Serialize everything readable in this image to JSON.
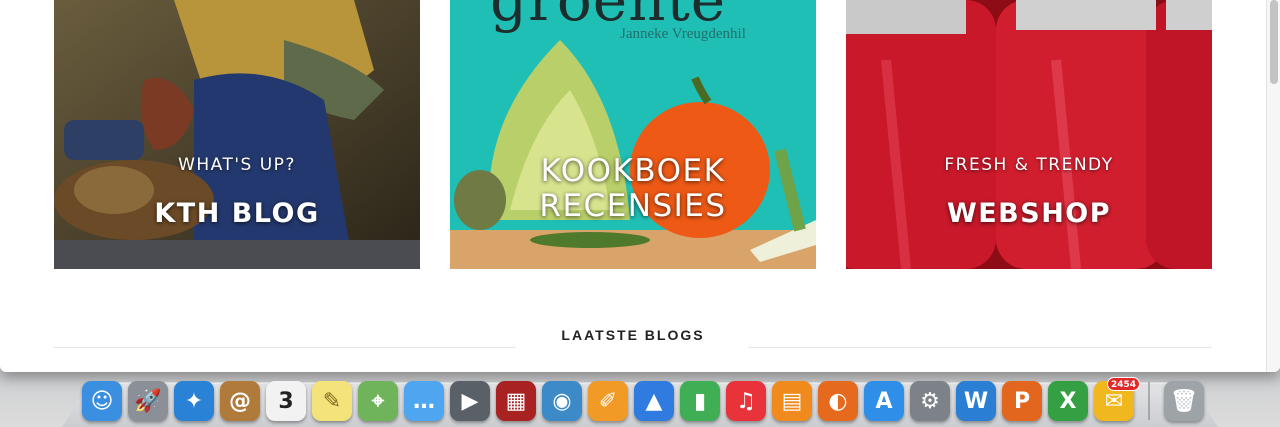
{
  "tiles": [
    {
      "kicker": "WHAT'S UP?",
      "title": "KTH BLOG"
    },
    {
      "book_title": "groente",
      "book_author": "Janneke Vreugdenhil",
      "title_line1": "KOOKBOEK",
      "title_line2": "RECENSIES"
    },
    {
      "kicker": "FRESH & TRENDY",
      "title": "WEBSHOP"
    }
  ],
  "section": {
    "heading": "LAATSTE BLOGS"
  },
  "dock": {
    "apps": [
      {
        "name": "finder",
        "glyph": "☺",
        "color": "#3a8fe0"
      },
      {
        "name": "launchpad",
        "glyph": "🚀",
        "color": "#8a8f98"
      },
      {
        "name": "safari",
        "glyph": "✦",
        "color": "#2a82d6"
      },
      {
        "name": "contacts",
        "glyph": "@",
        "color": "#b07a3a"
      },
      {
        "name": "calendar",
        "glyph": "3",
        "color": "#f2f2f2",
        "text_color": "#222"
      },
      {
        "name": "notes",
        "glyph": "✎",
        "color": "#f4e27a",
        "text_color": "#7a6a20"
      },
      {
        "name": "maps",
        "glyph": "⌖",
        "color": "#6fb35a"
      },
      {
        "name": "messages",
        "glyph": "…",
        "color": "#4ea6f0"
      },
      {
        "name": "facetime",
        "glyph": "▶",
        "color": "#5a6068"
      },
      {
        "name": "photo-booth",
        "glyph": "▦",
        "color": "#a82222"
      },
      {
        "name": "iphoto",
        "glyph": "◉",
        "color": "#3d8ac9"
      },
      {
        "name": "pages",
        "glyph": "✐",
        "color": "#f29a26"
      },
      {
        "name": "keynote",
        "glyph": "▲",
        "color": "#2f7be0"
      },
      {
        "name": "numbers",
        "glyph": "▮",
        "color": "#3fae54"
      },
      {
        "name": "itunes",
        "glyph": "♫",
        "color": "#e8333a"
      },
      {
        "name": "ibooks",
        "glyph": "▤",
        "color": "#f08a1c"
      },
      {
        "name": "firefox",
        "glyph": "◐",
        "color": "#e66a1e"
      },
      {
        "name": "app-store",
        "glyph": "A",
        "color": "#2e8ee8"
      },
      {
        "name": "system-preferences",
        "glyph": "⚙",
        "color": "#7d8288"
      },
      {
        "name": "word",
        "glyph": "W",
        "color": "#2a7fd4"
      },
      {
        "name": "powerpoint",
        "glyph": "P",
        "color": "#e3661f"
      },
      {
        "name": "excel",
        "glyph": "X",
        "color": "#35a043"
      },
      {
        "name": "outlook",
        "glyph": "✉",
        "color": "#f0b81e",
        "badge": "2454"
      }
    ],
    "trash": {
      "glyph": "🗑",
      "color": "#9ea3a8"
    }
  }
}
